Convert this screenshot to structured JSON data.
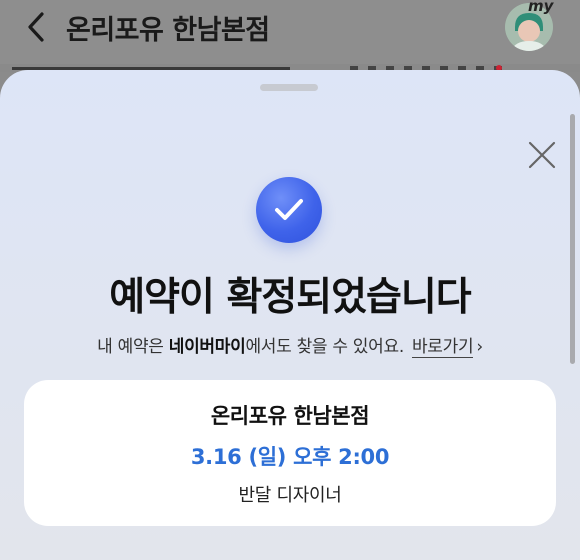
{
  "header": {
    "title": "온리포유 한남본점",
    "my_badge": "my",
    "back_icon": "chevron-left-icon"
  },
  "sheet": {
    "close_icon": "close-icon",
    "check_icon": "check-icon",
    "title": "예약이 확정되었습니다",
    "subtitle_prefix": "내 예약은 ",
    "subtitle_bold": "네이버마이",
    "subtitle_suffix": "에서도 찾을 수 있어요.",
    "shortcut_link": "바로가기",
    "shortcut_chevron": "›"
  },
  "reservation": {
    "store": "온리포유 한남본점",
    "datetime": "3.16 (일) 오후 2:00",
    "designer": "반달 디자이너"
  },
  "colors": {
    "accent_blue": "#2d6fd6",
    "check_blue": "#3f63ea"
  }
}
